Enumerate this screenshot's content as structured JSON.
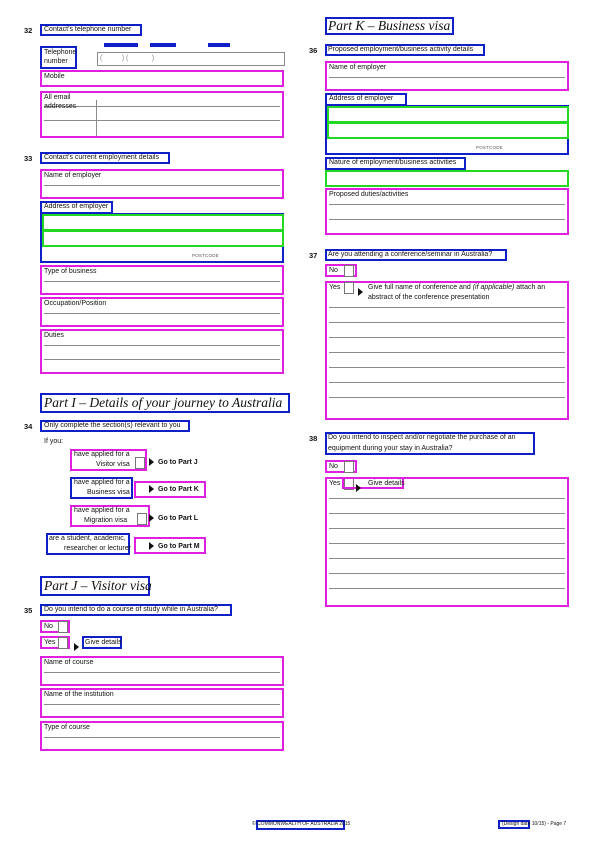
{
  "q32": {
    "number": "32",
    "label": "Contact's telephone number",
    "telephone": "Telephone",
    "number_word": "number",
    "mobile": "Mobile",
    "email_1": "All email",
    "email_2": "addresses"
  },
  "q33": {
    "number": "33",
    "label": "Contact's current employment details",
    "employer": "Name of employer",
    "address": "Address of employer",
    "postcode": "POSTCODE",
    "business": "Type of business",
    "occupation": "Occupation/Position",
    "duties": "Duties"
  },
  "part_i": {
    "heading": "Part I – Details of your journey to Australia"
  },
  "q34": {
    "number": "34",
    "label": "Only complete the section(s) relevant to you",
    "if_you": "If you:",
    "opt1_a": "have applied for a",
    "opt1_b": "Visitor visa",
    "go1": "Go to Part J",
    "opt2_a": "have applied for a",
    "opt2_b": "Business visa",
    "go2": "Go to Part K",
    "opt3_a": "have applied for a",
    "opt3_b": "Migration visa",
    "go3": "Go to Part L",
    "opt4_a": "are a student, academic,",
    "opt4_b": "researcher or lecturer",
    "go4": "Go to Part M"
  },
  "part_j": {
    "heading": "Part J – Visitor visa"
  },
  "q35": {
    "number": "35",
    "label": "Do you intend to do a course of study while in Australia?",
    "no": "No",
    "yes": "Yes",
    "give": "Give details",
    "course": "Name of course",
    "institution": "Name of the institution",
    "type": "Type of course"
  },
  "part_k": {
    "heading": "Part K – Business visa"
  },
  "q36": {
    "number": "36",
    "label": "Proposed employment/business activity details",
    "employer": "Name of employer",
    "address": "Address of employer",
    "postcode": "POSTCODE",
    "nature": "Nature of employment/business activities",
    "duties": "Proposed duties/activities"
  },
  "q37": {
    "number": "37",
    "label": "Are you attending a conference/seminar in Australia?",
    "no": "No",
    "yes": "Yes",
    "give_a": "Give full name of conference and",
    "give_b": "(if applicable)",
    "give_c": "attach an",
    "give_d": "abstract of the conference presentation"
  },
  "q38": {
    "number": "38",
    "label_a": "Do you intend to inspect and/or negotiate the purchase of an",
    "label_b": "equipment during your stay in Australia?",
    "no": "No",
    "yes": "Yes",
    "give": "Give details"
  },
  "footer": {
    "copyright": "© COMMONWEALTH OF AUSTRALIA 2015",
    "page": "(Design date 10/15) - Page 7"
  }
}
